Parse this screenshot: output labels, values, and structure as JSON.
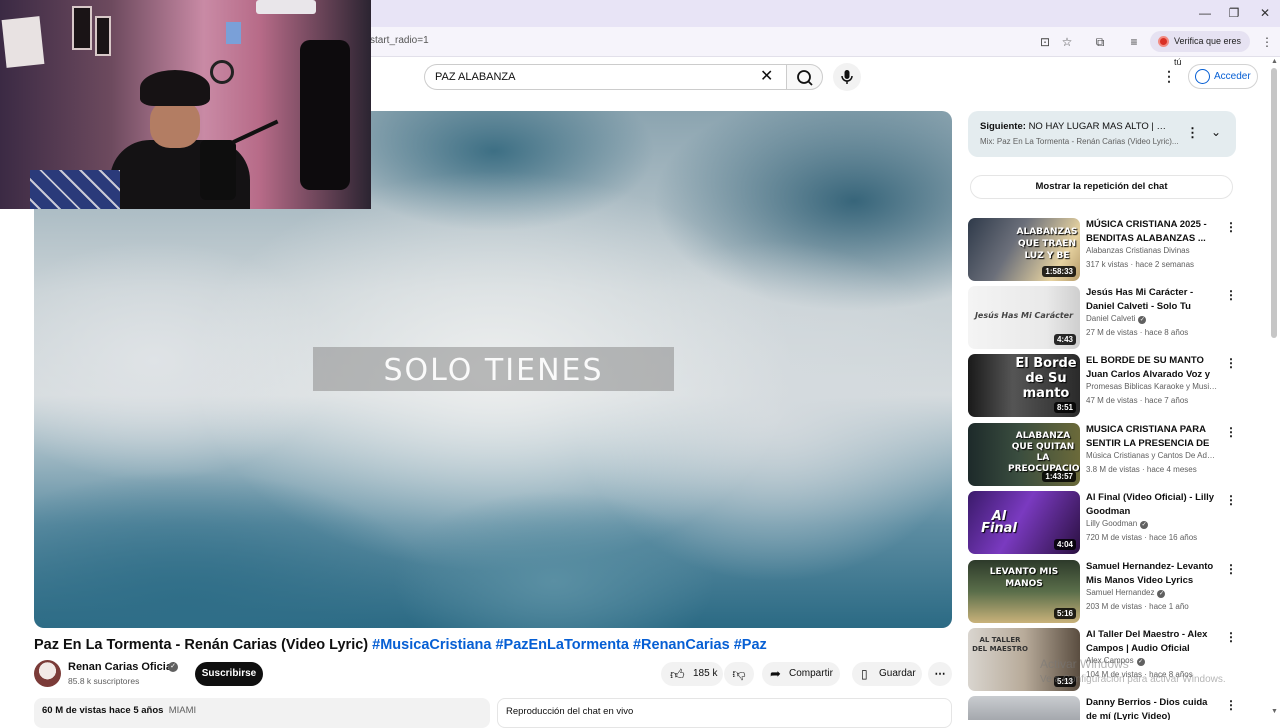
{
  "browser": {
    "url_fragment": "start_radio=1",
    "verify_label": "Verifica que eres tú",
    "window_buttons": [
      "—",
      "❐",
      "✕"
    ]
  },
  "header": {
    "search_query": "PAZ ALABANZA",
    "signin_label": "Acceder"
  },
  "player": {
    "lyric_overlay": "SOLO TIENES"
  },
  "video": {
    "title": "Paz En La Tormenta - Renán Carias (Video Lyric)",
    "hashtags": "#MusicaCristiana #PazEnLaTormenta #RenanCarias #Paz",
    "channel_name": "Renan Carias Oficial",
    "subscribers": "85.8 k suscriptores",
    "subscribe_label": "Suscribirse",
    "likes": "185 k",
    "share_label": "Compartir",
    "save_label": "Guardar",
    "views_date": "60 M de vistas  hace 5 años",
    "location": "MIAMI",
    "chat_replay_label": "Reproducción del chat en vivo"
  },
  "sidebar": {
    "next_prefix": "Siguiente:",
    "next_title": "NO HAY LUGAR MAS ALTO | Miel ...",
    "next_subtitle": "Mix: Paz En La Tormenta - Renán Carias (Video Lyric)...",
    "chat_button": "Mostrar la repetición del chat",
    "recommendations": [
      {
        "title": "MÚSICA CRISTIANA 2025 - BENDITAS ALABANZAS ...",
        "channel": "Alabanzas Cristianas Divinas",
        "meta": "317 k vistas · hace 2 semanas",
        "duration": "1:58:33",
        "overlay": "ALABANZAS QUE TRAEN LUZ Y BE"
      },
      {
        "title": "Jesús Has Mi Carácter - Daniel Calveti - Solo Tu Gracia | Video...",
        "channel": "Daniel Calveti",
        "meta": "27 M de vistas · hace 8 años",
        "duration": "4:43",
        "overlay": "Jesús Has Mi Carácter"
      },
      {
        "title": "EL BORDE DE SU MANTO  Juan Carlos Alvarado Voz y letra",
        "channel": "Promesas Biblicas Karaoke y Musica Cri...",
        "meta": "47 M de vistas · hace 7 años",
        "duration": "8:51",
        "overlay": "El Borde de Su manto"
      },
      {
        "title": "MUSICA CRISTIANA PARA SENTIR LA PRESENCIA DE DI...",
        "channel": "Música Cristianas y Cantos De Adoración",
        "meta": "3.8 M de vistas · hace 4 meses",
        "duration": "1:43:57",
        "overlay": "ALABANZA QUE QUITAN LA PREOCUPACION"
      },
      {
        "title": "Al Final (Video Oficial) - Lilly Goodman",
        "channel": "Lilly Goodman",
        "meta": "720 M de vistas · hace 16 años",
        "duration": "4:04",
        "overlay": "Al Final"
      },
      {
        "title": "Samuel Hernandez- Levanto Mis Manos Video Lyrics Oficial",
        "channel": "Samuel Hernandez",
        "meta": "203 M de vistas · hace 1 año",
        "duration": "5:16",
        "overlay": "LEVANTO MIS MANOS"
      },
      {
        "title": "Al Taller Del Maestro - Alex Campos | Audio Oficial",
        "channel": "Alex Campos",
        "meta": "104 M de vistas · hace 8 años",
        "duration": "5:13",
        "overlay": "AL TALLER DEL MAESTRO"
      },
      {
        "title": "Danny Berrios - Dios cuida de mí (Lyric Video)",
        "channel": "",
        "meta": "",
        "duration": "",
        "overlay": ""
      }
    ]
  },
  "watermark": {
    "line1": "Activar Windows",
    "line2": "Ve a Configuración para activar Windows."
  },
  "colors": {
    "accent": "#065fd4",
    "subscribe_bg": "#0f0f0f",
    "next_box_bg": "#e4ecef",
    "titlebar_bg": "#e8e4f6"
  }
}
